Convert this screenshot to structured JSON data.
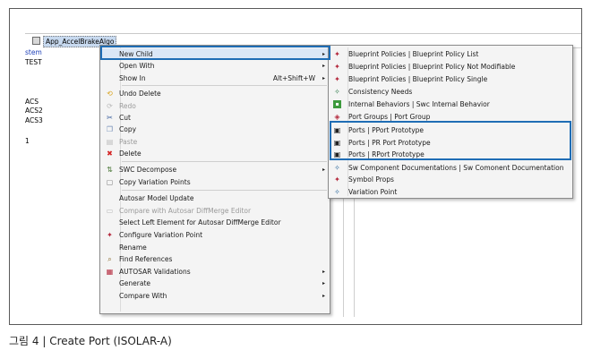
{
  "tree": {
    "root_label": "App_AccelBrakeAlgo",
    "lines": [
      "stem",
      "TEST",
      "ACS",
      "ACS2",
      "ACS3",
      "1"
    ]
  },
  "context_menu": {
    "items": [
      {
        "label": "New Child",
        "arrow": "▸",
        "selected": true
      },
      {
        "label": "Open With",
        "arrow": "▸"
      },
      {
        "label": "Show In",
        "shortcut": "Alt+Shift+W",
        "arrow": "▸"
      },
      {
        "label": "Undo Delete",
        "icon": "undo-icon"
      },
      {
        "label": "Redo",
        "icon": "redo-icon",
        "disabled": true
      },
      {
        "label": "Cut",
        "icon": "scissors-icon"
      },
      {
        "label": "Copy",
        "icon": "copy-icon"
      },
      {
        "label": "Paste",
        "icon": "paste-icon",
        "disabled": true
      },
      {
        "label": "Delete",
        "icon": "delete-icon"
      },
      {
        "label": "SWC Decompose",
        "icon": "decompose-icon",
        "arrow": "▸"
      },
      {
        "label": "Copy Variation Points",
        "icon": "copy-variation-icon"
      },
      {
        "label": "Autosar Model Update"
      },
      {
        "label": "Compare with Autosar DiffMerge Editor",
        "icon": "compare-icon",
        "disabled": true
      },
      {
        "label": "Select Left Element for Autosar DiffMerge Editor"
      },
      {
        "label": "Configure Variation Point",
        "icon": "variation-point-icon"
      },
      {
        "label": "Rename"
      },
      {
        "label": "Find References",
        "icon": "find-references-icon"
      },
      {
        "label": "AUTOSAR Validations",
        "icon": "validation-icon",
        "arrow": "▸"
      },
      {
        "label": "Generate",
        "arrow": "▸"
      },
      {
        "label": "Compare With",
        "arrow": "▸"
      }
    ]
  },
  "submenu": {
    "items": [
      {
        "label": "Blueprint Policies | Blueprint Policy List",
        "icon": "blueprint-policy-icon"
      },
      {
        "label": "Blueprint Policies | Blueprint Policy Not Modifiable",
        "icon": "blueprint-policy-icon"
      },
      {
        "label": "Blueprint Policies | Blueprint Policy Single",
        "icon": "blueprint-policy-icon"
      },
      {
        "label": "Consistency Needs",
        "icon": "consistency-icon"
      },
      {
        "label": "Internal Behaviors | Swc Internal Behavior",
        "icon": "internal-behavior-icon"
      },
      {
        "label": "Port Groups | Port Group",
        "icon": "port-group-icon"
      },
      {
        "label": "Ports | PPort Prototype",
        "icon": "pport-icon"
      },
      {
        "label": "Ports | PR Port Prototype",
        "icon": "prport-icon"
      },
      {
        "label": "Ports | RPort Prototype",
        "icon": "rport-icon"
      },
      {
        "label": "Sw Component Documentations | Sw Comonent Documentation",
        "icon": "documentation-icon"
      },
      {
        "label": "Symbol Props",
        "icon": "symbol-props-icon"
      },
      {
        "label": "Variation Point",
        "icon": "variation-point-icon"
      }
    ]
  },
  "caption": "그림 4 | Create Port (ISOLAR-A)",
  "colors": {
    "highlight": "#1f6db5",
    "selection": "#dbe7f6"
  }
}
